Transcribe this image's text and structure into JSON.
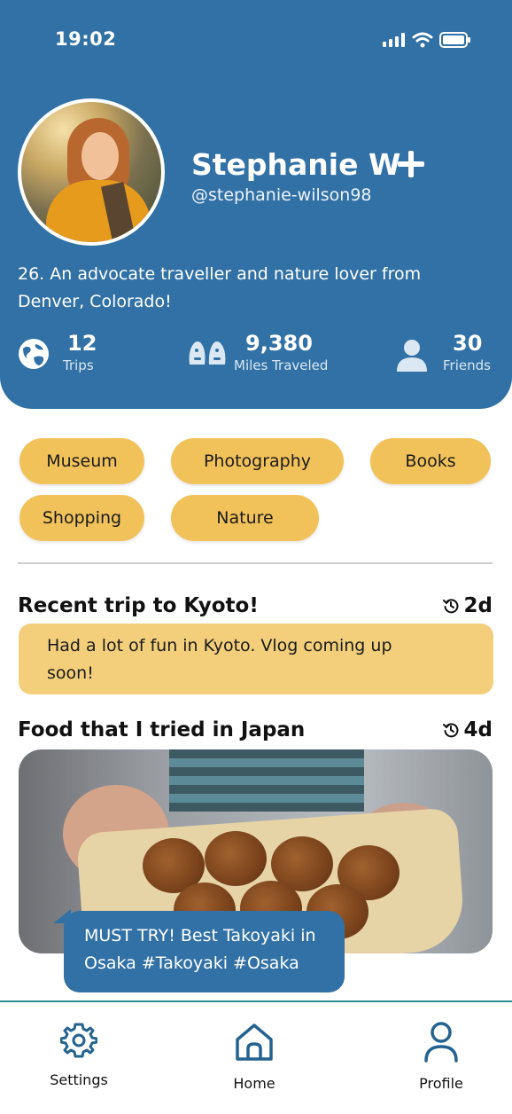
{
  "status_bar": {
    "time": "19:02"
  },
  "profile": {
    "name": "Stephanie W",
    "handle": "@stephanie-wilson98",
    "bio": "26. An advocate traveller and nature lover from Denver, Colorado!",
    "stats": [
      {
        "value": "12",
        "label": "Trips",
        "icon": "globe-icon"
      },
      {
        "value": "9,380",
        "label": "Miles Traveled",
        "icon": "footprints-icon"
      },
      {
        "value": "30",
        "label": "Friends",
        "icon": "person-icon"
      }
    ]
  },
  "interests": [
    "Museum",
    "Photography",
    "Books",
    "Shopping",
    "Nature"
  ],
  "posts": [
    {
      "title": "Recent trip to Kyoto!",
      "time": "2d",
      "text": "Had a lot of fun in Kyoto. Vlog coming up soon!"
    },
    {
      "title": "Food that I tried in Japan",
      "time": "4d",
      "caption": "MUST TRY! Best Takoyaki in Osaka #Takoyaki #Osaka"
    }
  ],
  "nav": [
    {
      "label": "Settings",
      "icon": "gear-icon"
    },
    {
      "label": "Home",
      "icon": "home-icon"
    },
    {
      "label": "Profile",
      "icon": "person-outline-icon"
    }
  ],
  "colors": {
    "primary": "#3171a6",
    "chip": "#f2c25a",
    "note": "#f4cf7b"
  }
}
